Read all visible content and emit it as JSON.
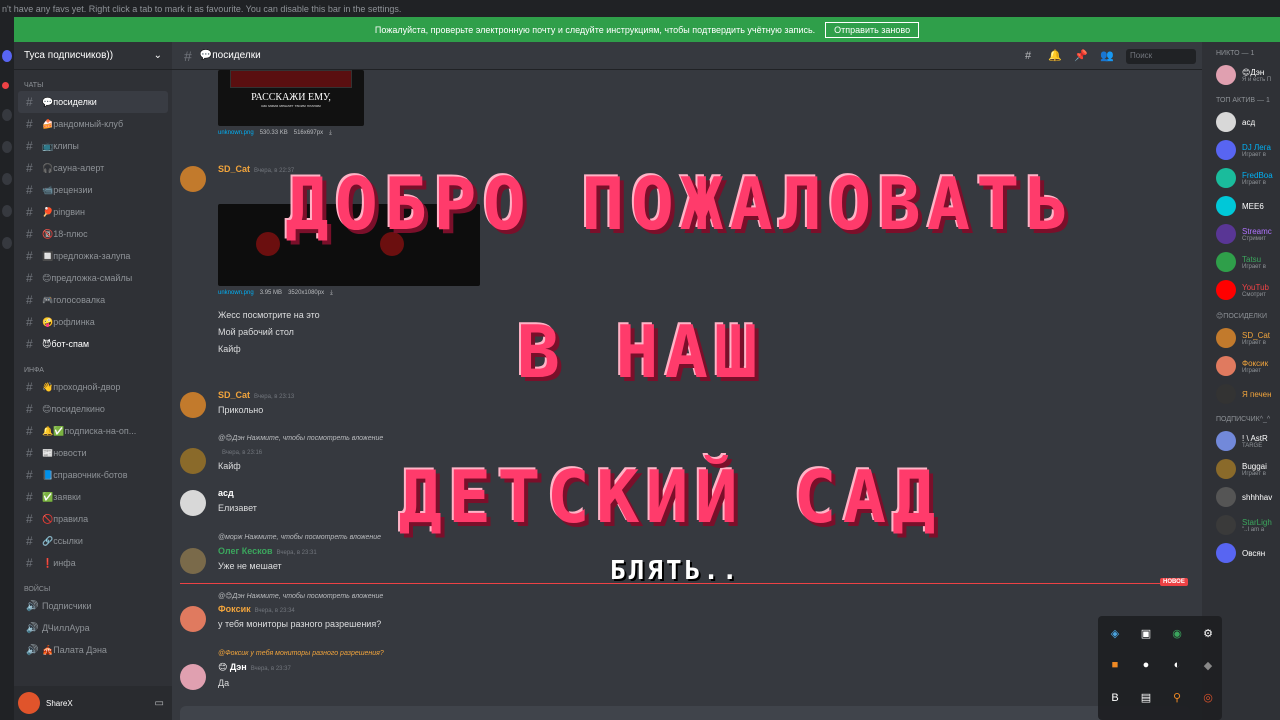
{
  "topbar": {
    "text": "n't have any favs yet. Right click a tab to mark it as favourite. You can disable this bar in the settings."
  },
  "verify": {
    "message": "Пожалуйста, проверьте электронную почту и следуйте инструкциям, чтобы подтвердить учётную запись.",
    "button": "Отправить заново"
  },
  "server": {
    "name": "Туса подписчиков))"
  },
  "categories": {
    "chats": "ЧАТЫ",
    "info": "ИНФА",
    "voice": "ВОЙСЫ"
  },
  "channels": [
    {
      "label": "💬посиделки",
      "active": true
    },
    {
      "label": "🍰рандомный-клуб"
    },
    {
      "label": "📺клипы"
    },
    {
      "label": "🎧сауна-алерт"
    },
    {
      "label": "📹рецензии"
    },
    {
      "label": "🏓pingвин"
    },
    {
      "label": "🔞18-плюс"
    },
    {
      "label": "🔲предложка-залупа"
    },
    {
      "label": "😊предложка-смайлы"
    },
    {
      "label": "🎮голосовалка"
    },
    {
      "label": "🤪рофлинка"
    },
    {
      "label": "😈бот-спам",
      "bold": true
    }
  ],
  "info_channels": [
    {
      "label": "👋проходной-двор"
    },
    {
      "label": "😊посиделкино"
    },
    {
      "label": "🔔✅подписка-на-оп..."
    },
    {
      "label": "📰новости"
    },
    {
      "label": "📘справочник-ботов"
    },
    {
      "label": "✅заявки"
    },
    {
      "label": "🚫правила"
    },
    {
      "label": "🔗ссылки"
    },
    {
      "label": "❗инфа"
    }
  ],
  "voice_channels": [
    {
      "label": "Подписчики"
    },
    {
      "label": "ДЧиллАура"
    },
    {
      "label": "🎪Палата Дэна"
    }
  ],
  "user_panel": {
    "name": "ShareX"
  },
  "channel_header": {
    "name": "💬посиделки"
  },
  "search": {
    "placeholder": "Поиск"
  },
  "messages": {
    "img1": {
      "caption": "РАССКАЖИ ЕМУ,",
      "subcaption": "как мама мешает твоим планам",
      "file": "unknown.png",
      "size": "530.33 KB",
      "dims": "516x697px"
    },
    "m1": {
      "author": "SD_Cat",
      "time": "Вчера, в 22:37"
    },
    "img2": {
      "file": "unknown.png",
      "size": "3.95 MB",
      "dims": "3520x1080px"
    },
    "m1_lines": [
      "Жесс посмотрите на это",
      "Мой рабочий стол",
      "Кайф"
    ],
    "m2": {
      "author": "SD_Cat",
      "time": "Вчера, в 23:13",
      "text": "Прикольно"
    },
    "m3_reply": "@😊Дэн Нажмите, чтобы посмотреть вложение",
    "m3": {
      "time": "Вчера, в 23:16",
      "text": "Кайф"
    },
    "m4": {
      "author": "асд",
      "text": "Елизавет"
    },
    "m5_reply": "@морж Нажмите, чтобы посмотреть вложение",
    "m5": {
      "author": "Олег Кесков",
      "time": "Вчера, в 23:31",
      "text": "Уже не мешает"
    },
    "new_badge": "НОВОЕ",
    "m6_reply": "@😊Дэн Нажмите, чтобы посмотреть вложение",
    "m6": {
      "author": "Фоксик",
      "time": "Вчера, в 23:34",
      "text": "у тебя мониторы разного разрешения?"
    },
    "m7_reply": "@Фоксик у тебя мониторы разного разрешения?",
    "m7": {
      "author": "😊 Дэн",
      "time": "Вчера, в 23:37",
      "text": "Да"
    }
  },
  "members": {
    "cat1": "НИКТО — 1",
    "m_den": {
      "name": "😊Дэн",
      "status": "Я и есть П"
    },
    "cat2": "ТОП АКТИВ — 1",
    "m_asd": {
      "name": "асд"
    },
    "m_dj": {
      "name": "DJ Лега",
      "status": "Играет в"
    },
    "m_fred": {
      "name": "FredBoa",
      "status": "Играет в"
    },
    "m_mee6": {
      "name": "MEE6"
    },
    "m_stream": {
      "name": "Streamc",
      "status": "Стримит"
    },
    "m_tatsu": {
      "name": "Tatsu",
      "status": "Играет в"
    },
    "m_yt": {
      "name": "YouTub",
      "status": "Смотрит"
    },
    "cat3": "😊ПОСИДЕЛКИ",
    "m_sdcat": {
      "name": "SD_Cat",
      "status": "Играет в"
    },
    "m_foks": {
      "name": "Фоксик",
      "status": "Играет"
    },
    "m_pech": {
      "name": "Я печен"
    },
    "cat4": "ПОДПИСЧИК^_^",
    "m_astr": {
      "name": "! \\ AstR",
      "status": "TARGE"
    },
    "m_bug": {
      "name": "Buggai",
      "status": "Играет в"
    },
    "m_shh": {
      "name": "shhhhav"
    },
    "m_star": {
      "name": "StarLigh",
      "status": "\"..I am a"
    },
    "m_ovs": {
      "name": "Овсян"
    }
  },
  "overlay": {
    "line1": "ДОБРО ПОЖАЛОВАТЬ",
    "line2": "В НАШ",
    "line3": "ДЕТСКИЙ САД",
    "line4": "БЛЯТЬ.."
  },
  "colors": {
    "accent": "#ff3b6b",
    "green": "#2f9f4a",
    "online": "#3ba55d",
    "red": "#ed4245",
    "blurple": "#5865f2"
  }
}
